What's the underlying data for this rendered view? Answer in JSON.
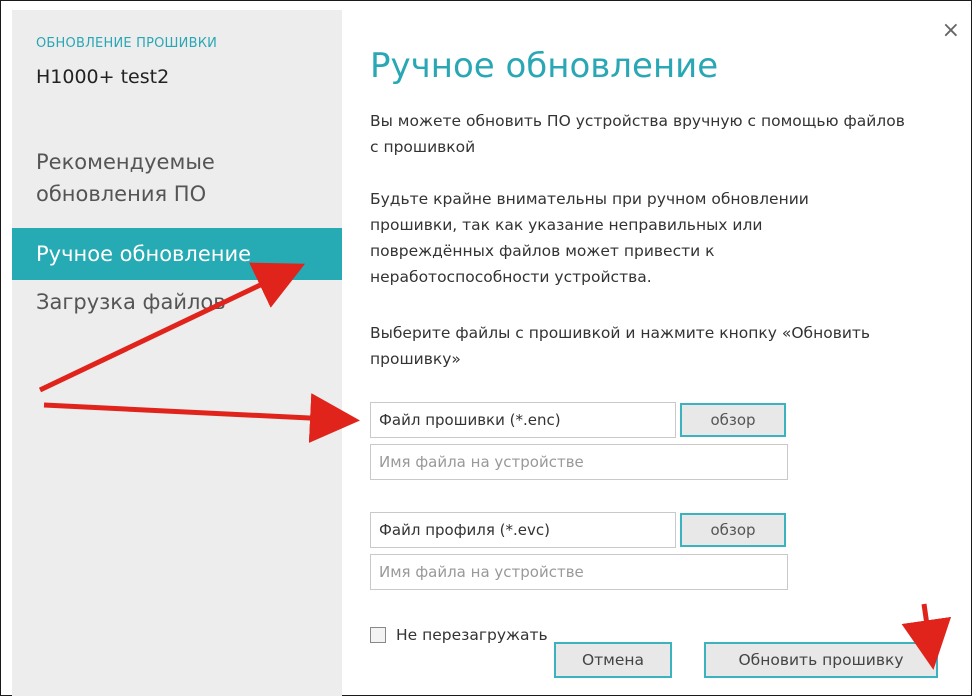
{
  "sidebar": {
    "section_label": "ОБНОВЛЕНИЕ ПРОШИВКИ",
    "device_name": "H1000+ test2",
    "items": [
      {
        "label": "Рекомендуемые обновления ПО"
      },
      {
        "label": "Ручное обновление"
      },
      {
        "label": "Загрузка файлов"
      }
    ]
  },
  "dialog": {
    "close_icon": "×",
    "title": "Ручное обновление",
    "paragraphs": [
      "Вы можете обновить ПО устройства вручную с помощью файлов с прошивкой",
      "Будьте крайне внимательны при ручном обновлении прошивки, так как указание неправильных или повреждённых файлов может привести к неработоспособности устройства.",
      "Выберите файлы с прошивкой и нажмите кнопку «Обновить прошивку»"
    ],
    "firmware_file": {
      "value": "Файл прошивки (*.enc)",
      "browse_label": "обзор"
    },
    "firmware_name": {
      "placeholder": "Имя файла на устройстве"
    },
    "profile_file": {
      "value": "Файл профиля (*.evc)",
      "browse_label": "обзор"
    },
    "profile_name": {
      "placeholder": "Имя файла на устройстве"
    },
    "no_reboot_label": "Не перезагружать",
    "cancel_label": "Отмена",
    "update_label": "Обновить прошивку"
  },
  "colors": {
    "accent": "#26aab4",
    "arrow": "#e0241b"
  }
}
